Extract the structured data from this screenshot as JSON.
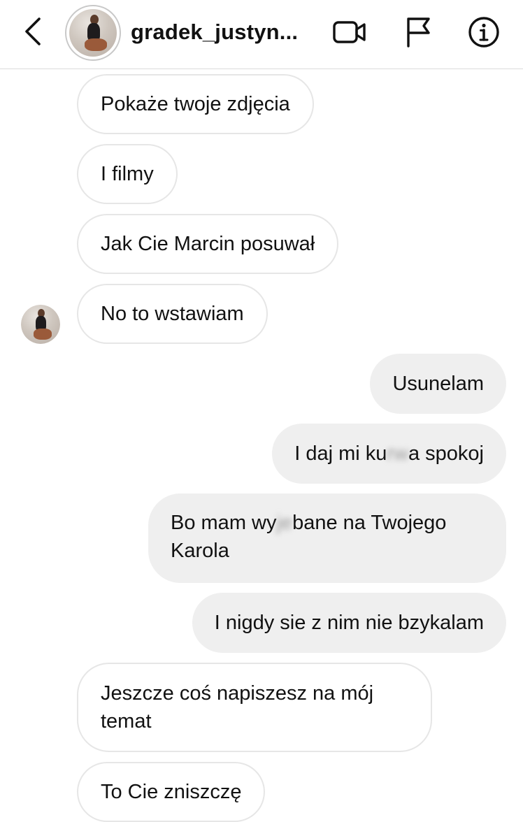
{
  "header": {
    "username": "gradek_justyn...",
    "icons": {
      "back": "chevron-left-icon",
      "video": "video-camera-icon",
      "flag": "flag-icon",
      "info": "info-icon"
    }
  },
  "messages": [
    {
      "direction": "incoming",
      "segments": [
        "Pokaże twoje zdjęcia"
      ]
    },
    {
      "direction": "incoming",
      "segments": [
        "I filmy"
      ]
    },
    {
      "direction": "incoming",
      "segments": [
        "Jak Cie Marcin posuwał"
      ]
    },
    {
      "direction": "incoming",
      "segments": [
        "No to wstawiam"
      ]
    },
    {
      "direction": "outgoing",
      "segments": [
        "Usunelam"
      ]
    },
    {
      "direction": "outgoing",
      "segments": [
        "I daj mi ku",
        "rw",
        "a spokoj"
      ]
    },
    {
      "direction": "outgoing",
      "segments": [
        "Bo mam wy",
        "je",
        "bane na Twojego Karola"
      ]
    },
    {
      "direction": "outgoing",
      "segments": [
        "I nigdy sie z nim nie bzykalam"
      ]
    },
    {
      "direction": "incoming",
      "segments": [
        "Jeszcze coś napiszesz na mój temat"
      ]
    },
    {
      "direction": "incoming",
      "segments": [
        "To Cie zniszczę"
      ]
    }
  ],
  "colors": {
    "incoming_bubble_bg": "#ffffff",
    "incoming_bubble_border": "#e6e6e6",
    "outgoing_bubble_bg": "#efefef",
    "text": "#111111",
    "divider": "#dcdcdc"
  }
}
